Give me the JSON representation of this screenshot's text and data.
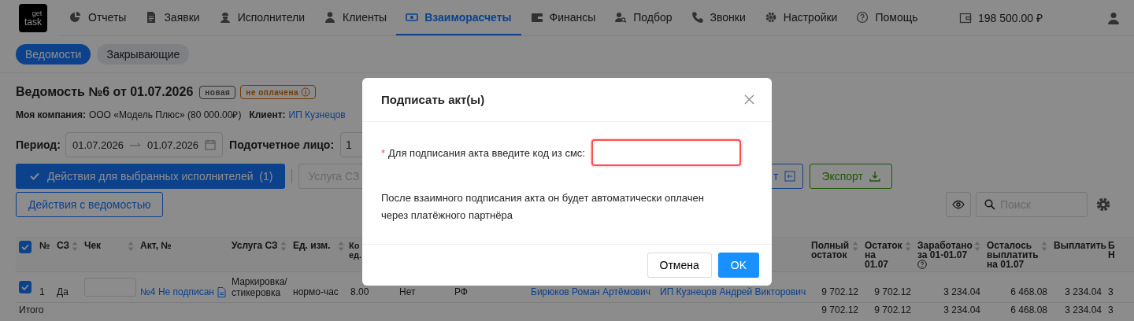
{
  "logo": {
    "top": "get",
    "bottom": "task"
  },
  "nav": [
    {
      "label": "Отчеты",
      "selected": false
    },
    {
      "label": "Заявки",
      "selected": false
    },
    {
      "label": "Исполнители",
      "selected": false
    },
    {
      "label": "Клиенты",
      "selected": false
    },
    {
      "label": "Взаиморасчеты",
      "selected": true
    },
    {
      "label": "Финансы",
      "selected": false
    },
    {
      "label": "Подбор",
      "selected": false
    },
    {
      "label": "Звонки",
      "selected": false
    },
    {
      "label": "Настройки",
      "selected": false
    },
    {
      "label": "Помощь",
      "selected": false
    }
  ],
  "balance": "198 500.00 ₽",
  "subtabs": [
    {
      "label": "Ведомости",
      "selected": true
    },
    {
      "label": "Закрывающие",
      "selected": false
    }
  ],
  "statement": {
    "title": "Ведомость №6 от 01.07.2026",
    "badges": [
      {
        "label": "новая",
        "kind": "default",
        "info": false
      },
      {
        "label": "не оплачена",
        "kind": "warning",
        "info": true
      }
    ],
    "company_label": "Моя компания:",
    "company": "ООО «Модель Плюс» (80 000.00₽)",
    "client_label": "Клиент:",
    "client": "ИП Кузнецов"
  },
  "filters": {
    "period_label": "Период:",
    "date_from": "01.07.2026",
    "date_to": "01.07.2026",
    "person_label": "Подотчетное лицо:",
    "person_value": "1"
  },
  "actions": {
    "selected_actions": "Действия для выбранных исполнителей  (1)",
    "service_placeholder": "Услуга СЗ",
    "import_visible": "т",
    "export": "Экспорт",
    "statement_actions": "Действия с ведомостью",
    "search_placeholder": "Поиск"
  },
  "table": {
    "select_all_checked": true,
    "columns_left": [
      {
        "label": "№",
        "sortable": false
      },
      {
        "label": "СЗ",
        "sortable": true
      },
      {
        "label": "Чек",
        "sortable": true
      },
      {
        "label": "Акт, №",
        "sortable": false
      },
      {
        "label": "Услуга СЗ",
        "sortable": true
      },
      {
        "label": "Ед. изм.",
        "sortable": true
      },
      {
        "label": "Ко\nед."
      }
    ],
    "columns_right": [
      {
        "label": "Полный\nостаток",
        "sortable": true,
        "help": false
      },
      {
        "label": "Остаток\nна\n01.07",
        "sortable": true,
        "help": false
      },
      {
        "label": "Заработано\nза 01-01.07",
        "sortable": true,
        "help": true
      },
      {
        "label": "Осталось\nвыплатить\nна 01.07",
        "sortable": true,
        "help": false
      },
      {
        "label": "Выплатить",
        "sortable": false,
        "help": false
      },
      {
        "label": "Б\nН",
        "sortable": false,
        "help": false
      }
    ],
    "rows": [
      {
        "checked": true,
        "number": "1",
        "sz": "Да",
        "act": "№4 Не подписан",
        "service": "Маркировка/\nстикеровка",
        "unit": "нормо-час",
        "quantity": "8.00",
        "column_9": "Нет",
        "column_10": "РФ",
        "executor": "Бирюков Роман Артёмович",
        "client": "ИП Кузнецов Андрей Викторович",
        "amounts": [
          "9 702.12",
          "9 702.12",
          "3 234.04",
          "6 468.08",
          "3 234.04",
          "3"
        ]
      }
    ],
    "total": {
      "label": "Итого",
      "amounts": [
        "9 702.12",
        "9 702.12",
        "3 234.04",
        "6 468.08",
        "3 234.04",
        "3"
      ]
    }
  },
  "modal": {
    "title": "Подписать акт(ы)",
    "required_mark": "*",
    "label": "Для подписания акта введите код из смс:",
    "invalid": true,
    "note": "После взаимного подписания акта он будет автоматически оплачен через платёжного партнёра",
    "cancel": "Отмена",
    "ok": "OK"
  }
}
